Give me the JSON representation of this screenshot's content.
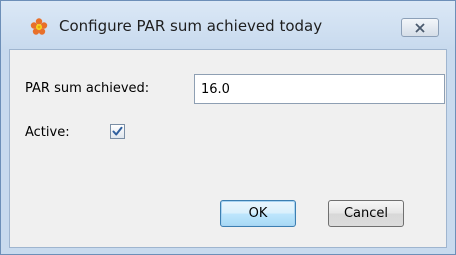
{
  "window": {
    "title": "Configure PAR sum achieved today",
    "icon": "flower-icon",
    "close_glyph": "close-icon"
  },
  "form": {
    "par_label": "PAR sum achieved:",
    "par_value": "16.0",
    "active_label": "Active:",
    "active_checked": true
  },
  "buttons": {
    "ok_label": "OK",
    "cancel_label": "Cancel"
  }
}
